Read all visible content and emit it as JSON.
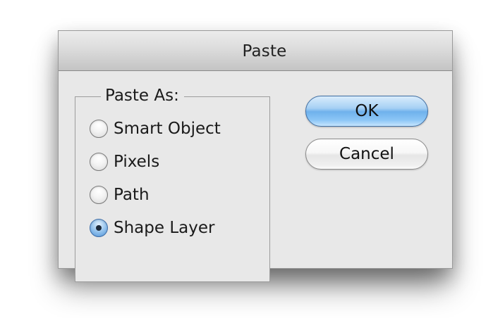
{
  "dialog": {
    "title": "Paste"
  },
  "paste_as": {
    "legend": "Paste As:",
    "options": [
      {
        "label": "Smart Object",
        "checked": false
      },
      {
        "label": "Pixels",
        "checked": false
      },
      {
        "label": "Path",
        "checked": false
      },
      {
        "label": "Shape Layer",
        "checked": true
      }
    ]
  },
  "buttons": {
    "ok_label": "OK",
    "cancel_label": "Cancel"
  }
}
